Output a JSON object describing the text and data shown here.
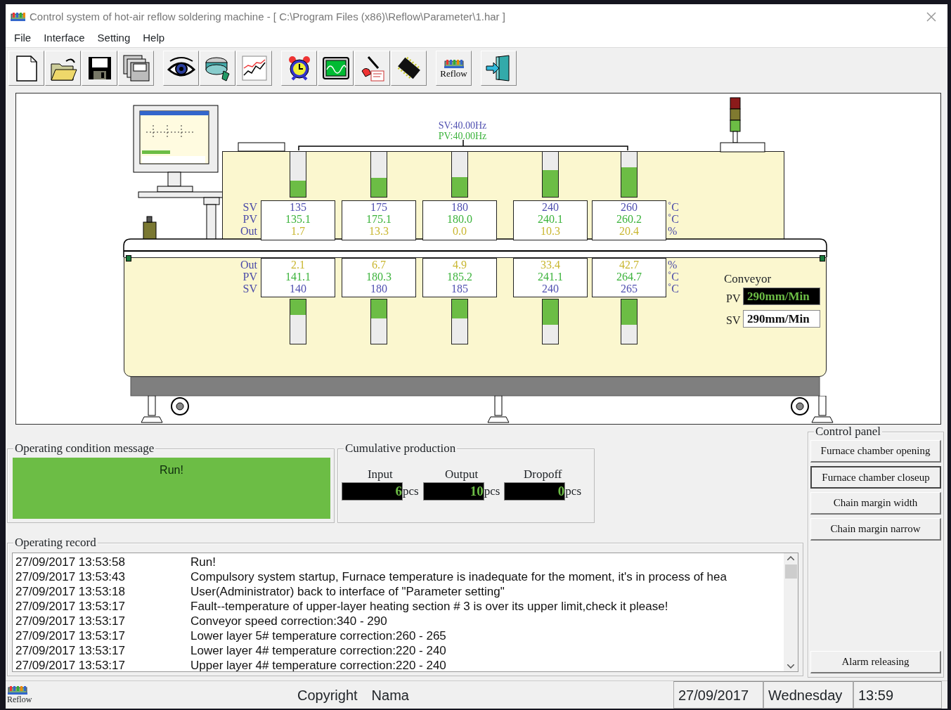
{
  "window": {
    "title": "Control system of hot-air reflow soldering machine - [ C:\\Program Files (x86)\\Reflow\\Parameter\\1.har ]"
  },
  "menu": [
    {
      "label": "File"
    },
    {
      "label": "Interface"
    },
    {
      "label": "Setting"
    },
    {
      "label": "Help"
    }
  ],
  "toolbar": {
    "reflow_button_label": "Reflow"
  },
  "machine": {
    "chain_speed": {
      "sv": "SV:40.00Hz",
      "pv": "PV:40.00Hz"
    },
    "upper_zones": {
      "row_labels": [
        "SV",
        "PV",
        "Out"
      ],
      "units": [
        "˚C",
        "˚C",
        "%"
      ],
      "zones": [
        {
          "sv": "135",
          "pv": "135.1",
          "out": "1.7",
          "level": 0.36
        },
        {
          "sv": "175",
          "pv": "175.1",
          "out": "13.3",
          "level": 0.42
        },
        {
          "sv": "180",
          "pv": "180.0",
          "out": "0.0",
          "level": 0.44
        },
        {
          "sv": "240",
          "pv": "240.1",
          "out": "10.3",
          "level": 0.59
        },
        {
          "sv": "260",
          "pv": "260.2",
          "out": "20.4",
          "level": 0.65
        }
      ]
    },
    "lower_zones": {
      "row_labels": [
        "Out",
        "PV",
        "SV"
      ],
      "units": [
        "%",
        "˚C",
        "˚C"
      ],
      "zones": [
        {
          "out": "2.1",
          "pv": "141.1",
          "sv": "140",
          "level": 0.35
        },
        {
          "out": "6.7",
          "pv": "180.3",
          "sv": "180",
          "level": 0.43
        },
        {
          "out": "4.9",
          "pv": "185.2",
          "sv": "185",
          "level": 0.43
        },
        {
          "out": "33.4",
          "pv": "241.1",
          "sv": "240",
          "level": 0.57
        },
        {
          "out": "42.7",
          "pv": "264.7",
          "sv": "265",
          "level": 0.57
        }
      ]
    },
    "conveyor": {
      "title": "Conveyor",
      "pv_label": "PV",
      "pv": "290mm/Min",
      "sv_label": "SV",
      "sv": "290mm/Min"
    }
  },
  "operating_condition": {
    "title": "Operating condition message",
    "message": "Run!"
  },
  "production": {
    "title": "Cumulative production",
    "counters": [
      {
        "label": "Input",
        "value": "6",
        "unit": "pcs"
      },
      {
        "label": "Output",
        "value": "10",
        "unit": "pcs"
      },
      {
        "label": "Dropoff",
        "value": "0",
        "unit": "pcs"
      }
    ]
  },
  "control_panel": {
    "title": "Control panel",
    "buttons": [
      {
        "label": "Furnace chamber opening",
        "focused": false
      },
      {
        "label": "Furnace chamber closeup",
        "focused": true
      },
      {
        "label": "Chain margin width",
        "focused": false
      },
      {
        "label": "Chain margin narrow",
        "focused": false
      }
    ],
    "bottom_button": {
      "label": "Alarm releasing",
      "focused": false
    }
  },
  "operating_record": {
    "title": "Operating record",
    "entries": [
      {
        "time": "27/09/2017 13:53:58",
        "message": "Run!"
      },
      {
        "time": "27/09/2017 13:53:43",
        "message": "Compulsory system startup, Furnace temperature is inadequate for the moment, it's in process of hea"
      },
      {
        "time": "27/09/2017 13:53:18",
        "message": "User(Administrator) back to interface of \"Parameter setting\""
      },
      {
        "time": "27/09/2017 13:53:17",
        "message": "Fault--temperature of upper-layer heating section # 3 is over its upper limit,check it please!"
      },
      {
        "time": "27/09/2017 13:53:17",
        "message": "Conveyor speed correction:340 - 290"
      },
      {
        "time": "27/09/2017 13:53:17",
        "message": "Lower layer 5# temperature correction:260 - 265"
      },
      {
        "time": "27/09/2017 13:53:17",
        "message": "Lower layer 4# temperature correction:220 - 240"
      },
      {
        "time": "27/09/2017 13:53:17",
        "message": "Upper layer 4# temperature correction:220 - 240"
      }
    ]
  },
  "status_bar": {
    "icon_label": "Reflow",
    "copyright": "Copyright",
    "owner": "Nama",
    "date": "27/09/2017",
    "weekday": "Wednesday",
    "time": "13:59"
  }
}
